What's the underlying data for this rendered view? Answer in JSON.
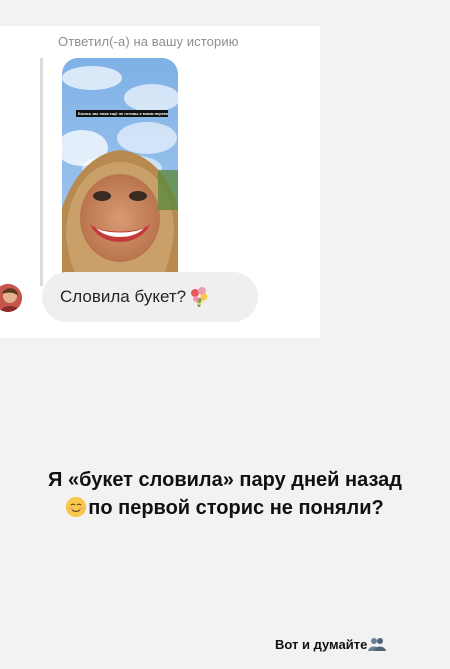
{
  "reply": {
    "caption": "Ответил(-а) на вашу историю",
    "story_caption": "Боюсь вы пока ещё не готовы к моим переменам в жизни"
  },
  "message": {
    "text": "Словила букет?",
    "emoji_icon": "bouquet-icon"
  },
  "headline": {
    "line1": "Я «букет словила» пару дней назад",
    "line2": "по первой сторис не поняли?",
    "emoji_icon": "relieved-face-icon"
  },
  "footer": {
    "text": "Вот и думайте",
    "emoji_icon": "busts-icon"
  },
  "colors": {
    "background": "#f2f2f2",
    "card": "#ffffff",
    "bubble": "#efefef",
    "caption": "#8e8e8e"
  }
}
